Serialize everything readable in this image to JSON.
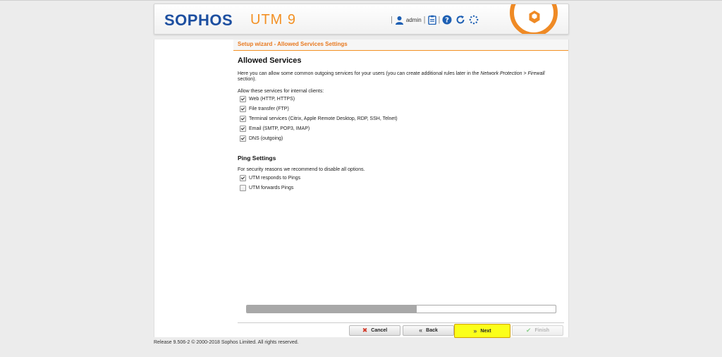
{
  "header": {
    "logo": "SOPHOS",
    "product": "UTM 9",
    "user": "admin"
  },
  "wizard": {
    "title": "Setup wizard - Allowed Services Settings"
  },
  "allowed": {
    "heading": "Allowed Services",
    "desc_before": "Here you can allow some common outgoing services for your users (you can create additional rules later in the ",
    "desc_link": "Network Protection > Firewall",
    "desc_after": " section).",
    "list_label": "Allow these services for internal clients:",
    "items": [
      {
        "label": "Web (HTTP, HTTPS)",
        "checked": true
      },
      {
        "label": "File transfer (FTP)",
        "checked": true
      },
      {
        "label": "Terminal services (Citrix, Apple Remote Desktop, RDP, SSH, Telnet)",
        "checked": true
      },
      {
        "label": "Email (SMTP, POP3, IMAP)",
        "checked": true
      },
      {
        "label": "DNS (outgoing)",
        "checked": true
      }
    ]
  },
  "ping": {
    "heading": "Ping Settings",
    "desc": "For security reasons we recommend to disable all options.",
    "items": [
      {
        "label": "UTM responds to Pings",
        "checked": true
      },
      {
        "label": "UTM forwards Pings",
        "checked": false
      }
    ]
  },
  "progress": {
    "fraction": 0.55
  },
  "buttons": {
    "cancel": "Cancel",
    "back": "Back",
    "next": "Next",
    "finish": "Finish"
  },
  "footer": {
    "text": "Release 9.506-2  © 2000-2018 Sophos Limited. All rights reserved."
  },
  "colors": {
    "brand_blue": "#1d4fa0",
    "accent_orange": "#f39125",
    "next_highlight": "#fbff1a"
  }
}
